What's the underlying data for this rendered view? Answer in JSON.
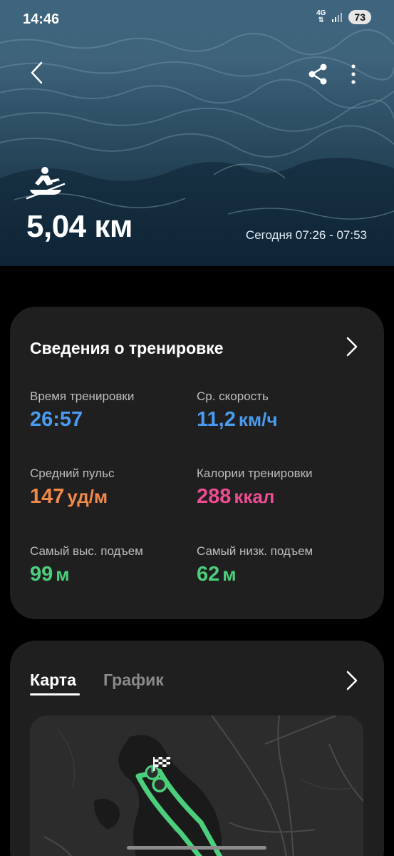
{
  "status_bar": {
    "time": "14:46",
    "network_label": "4G",
    "battery_level": "73"
  },
  "header": {
    "activity_icon": "rowing-icon",
    "distance": "5,04 км",
    "date_range": "Сегодня 07:26 - 07:53"
  },
  "details": {
    "title": "Сведения о тренировке",
    "stats": [
      {
        "label": "Время тренировки",
        "value": "26:57",
        "unit": "",
        "color": "#4a9bf0"
      },
      {
        "label": "Ср. скорость",
        "value": "11,2",
        "unit": "км/ч",
        "color": "#4a9bf0"
      },
      {
        "label": "Средний пульс",
        "value": "147",
        "unit": "уд/м",
        "color": "#f2884a"
      },
      {
        "label": "Калории тренировки",
        "value": "288",
        "unit": "ккал",
        "color": "#ee4c92"
      },
      {
        "label": "Самый выс. подъем",
        "value": "99",
        "unit": "м",
        "color": "#4ccf7c"
      },
      {
        "label": "Самый низк. подъем",
        "value": "62",
        "unit": "м",
        "color": "#4ccf7c"
      }
    ]
  },
  "map_card": {
    "tabs": [
      {
        "label": "Карта",
        "active": true
      },
      {
        "label": "График",
        "active": false
      }
    ],
    "route_color": "#4ccf7c"
  },
  "colors": {
    "background": "#000000",
    "card": "#1f1f1f",
    "accent_blue": "#4a9bf0",
    "accent_orange": "#f2884a",
    "accent_pink": "#ee4c92",
    "accent_green": "#4ccf7c"
  }
}
